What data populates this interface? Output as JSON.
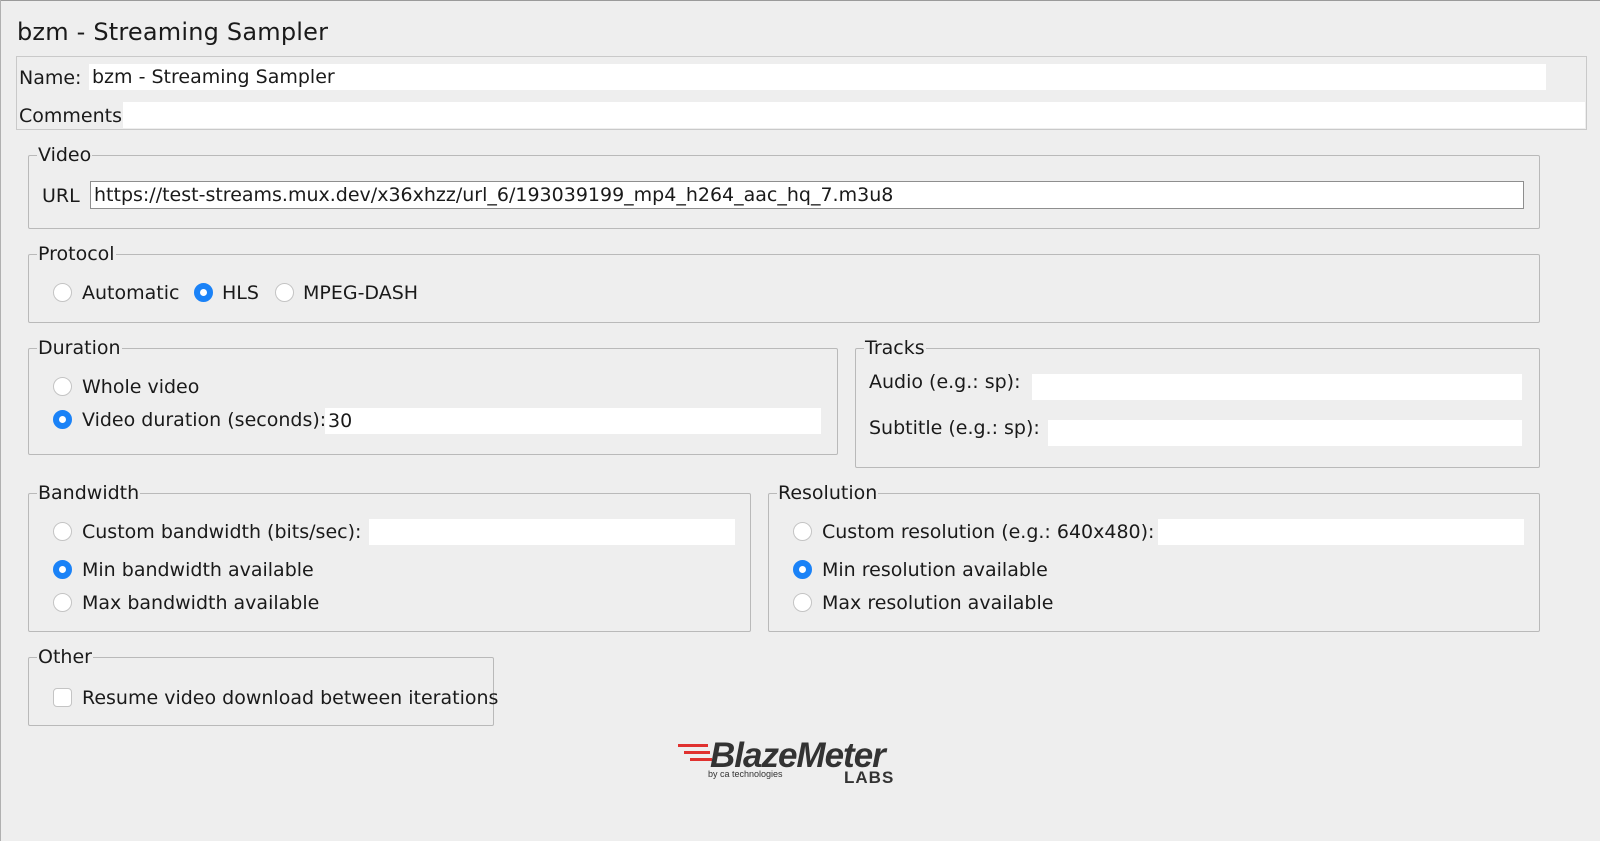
{
  "window": {
    "title": "bzm - Streaming Sampler"
  },
  "name_section": {
    "name_label": "Name:",
    "name_value": "bzm - Streaming Sampler",
    "comments_label": "Comments:",
    "comments_value": ""
  },
  "video": {
    "legend": "Video",
    "url_label": "URL",
    "url_value": "https://test-streams.mux.dev/x36xhzz/url_6/193039199_mp4_h264_aac_hq_7.m3u8"
  },
  "protocol": {
    "legend": "Protocol",
    "options": [
      {
        "label": "Automatic",
        "selected": false
      },
      {
        "label": "HLS",
        "selected": true
      },
      {
        "label": "MPEG-DASH",
        "selected": false
      }
    ]
  },
  "duration": {
    "legend": "Duration",
    "whole_label": "Whole video",
    "duration_label": "Video duration (seconds):",
    "duration_value": "30",
    "selected": "duration"
  },
  "tracks": {
    "legend": "Tracks",
    "audio_label": "Audio (e.g.: sp):",
    "audio_value": "",
    "subtitle_label": "Subtitle (e.g.: sp):",
    "subtitle_value": ""
  },
  "bandwidth": {
    "legend": "Bandwidth",
    "custom_label": "Custom bandwidth (bits/sec):",
    "custom_value": "",
    "min_label": "Min bandwidth available",
    "max_label": "Max bandwidth available",
    "selected": "min"
  },
  "resolution": {
    "legend": "Resolution",
    "custom_label": "Custom resolution (e.g.: 640x480):",
    "custom_value": "",
    "min_label": "Min resolution available",
    "max_label": "Max resolution available",
    "selected": "min"
  },
  "other": {
    "legend": "Other",
    "resume_label": "Resume video download between iterations",
    "resume_checked": false
  },
  "logo": {
    "brand": "BlazeMeter",
    "byline": "by ca technologies",
    "sub": "LABS",
    "accent_color": "#e0312f"
  },
  "colors": {
    "accent": "#1a82f7",
    "background": "#eeeeee"
  }
}
